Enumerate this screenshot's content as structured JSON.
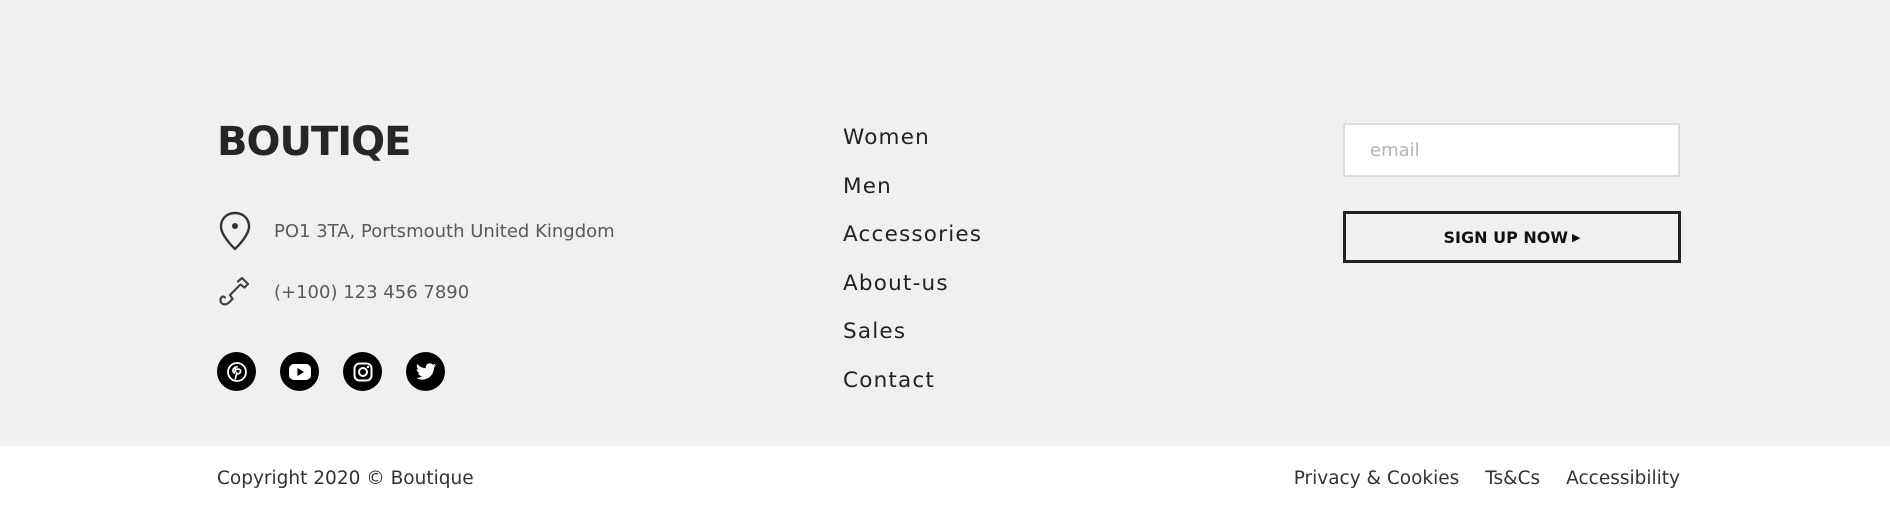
{
  "brand": {
    "logo_text": "BOUTIQE"
  },
  "contact": {
    "address": "PO1 3TA, Portsmouth United Kingdom",
    "phone": "(+100) 123 456 7890",
    "address_icon": "map-pin-icon",
    "phone_icon": "phone-icon"
  },
  "socials": [
    {
      "icon": "pinterest-icon"
    },
    {
      "icon": "youtube-icon"
    },
    {
      "icon": "instagram-icon"
    },
    {
      "icon": "twitter-icon"
    }
  ],
  "nav": {
    "items": [
      {
        "label": "Women"
      },
      {
        "label": "Men"
      },
      {
        "label": "Accessories"
      },
      {
        "label": "About-us"
      },
      {
        "label": "Sales"
      },
      {
        "label": "Contact"
      }
    ]
  },
  "newsletter": {
    "email_placeholder": "email",
    "email_value": "",
    "signup_label": "SIGN UP NOW",
    "signup_caret_icon": "caret-right-icon"
  },
  "bottom": {
    "copyright": "Copyright 2020 © Boutique",
    "links": [
      {
        "label": "Privacy & Cookies"
      },
      {
        "label": "Ts&Cs"
      },
      {
        "label": "Accessibility"
      }
    ]
  },
  "colors": {
    "footer_bg": "#f0f0f0",
    "bottom_bg": "#ffffff",
    "text_dark": "#222222",
    "social_bg": "#000000"
  }
}
